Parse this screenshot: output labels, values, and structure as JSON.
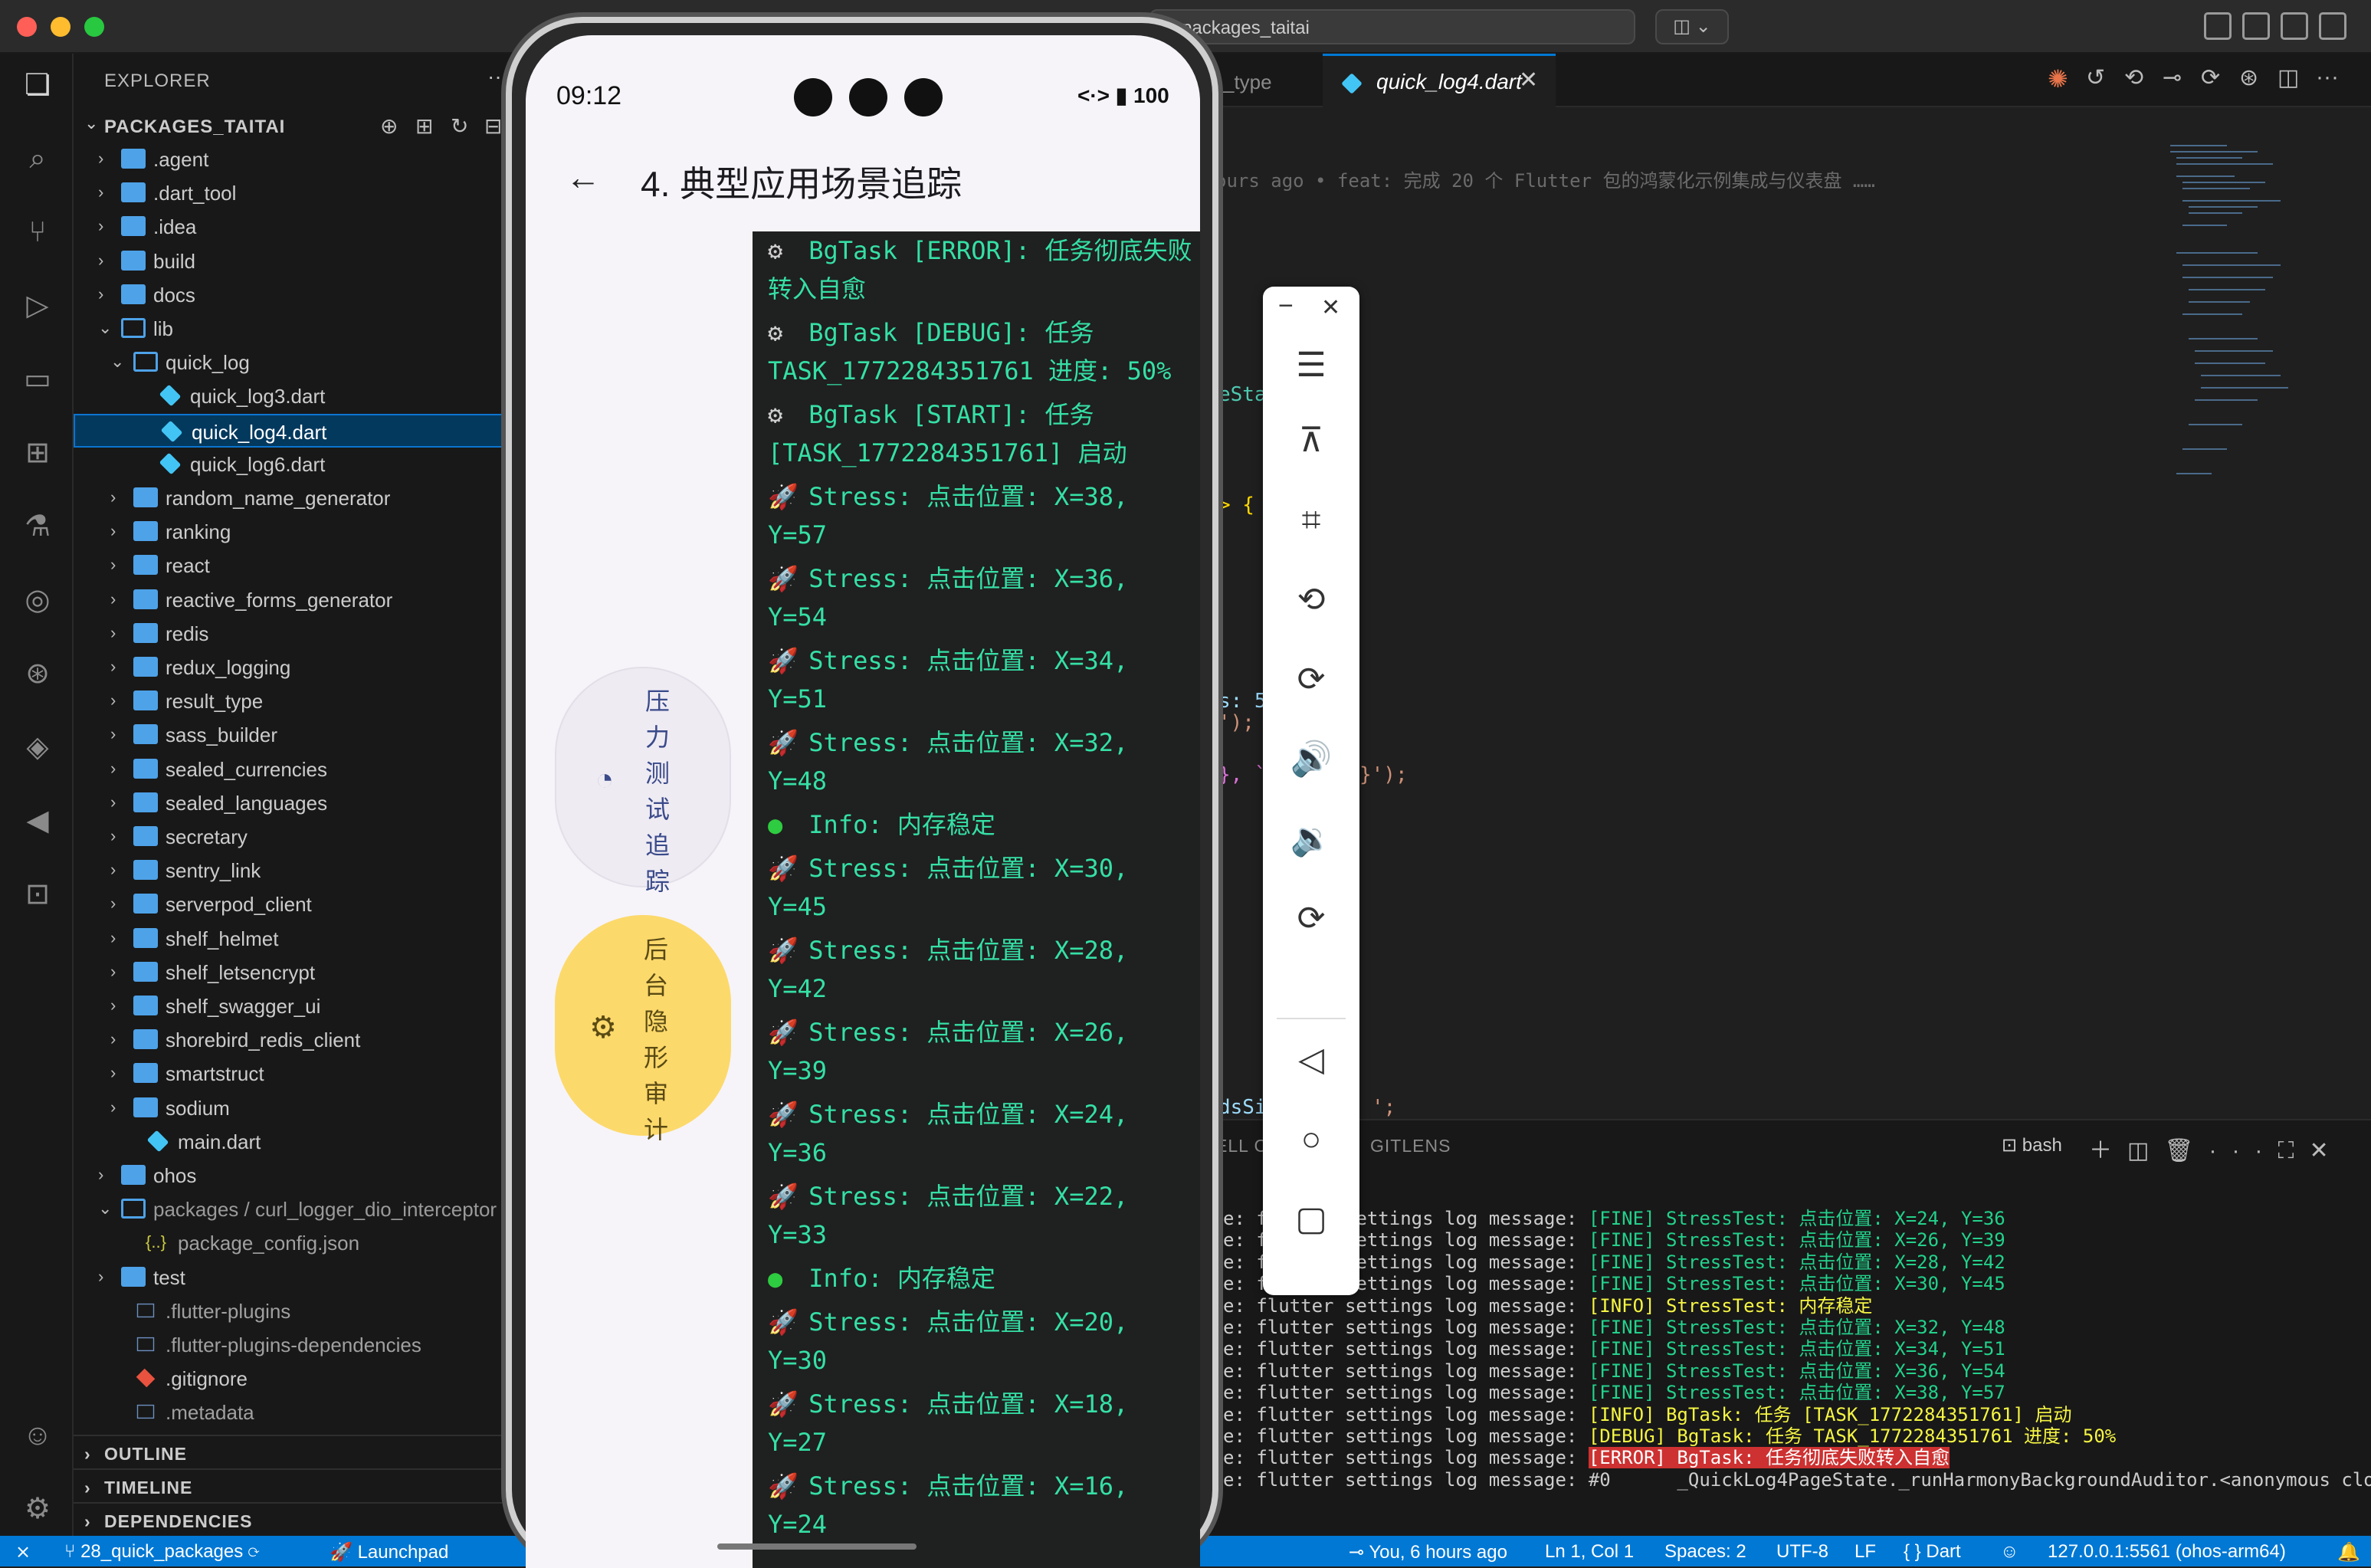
{
  "window": {
    "search_text": "packages_taitai",
    "copilot_label": "⌄"
  },
  "explorer": {
    "title": "EXPLORER",
    "more": "···",
    "workspace": "PACKAGES_TAITAI",
    "tree": [
      {
        "label": ".agent",
        "depth": 0,
        "type": "folder",
        "expanded": false
      },
      {
        "label": ".dart_tool",
        "depth": 0,
        "type": "folder",
        "expanded": false
      },
      {
        "label": ".idea",
        "depth": 0,
        "type": "folder",
        "expanded": false
      },
      {
        "label": "build",
        "depth": 0,
        "type": "folder",
        "expanded": false
      },
      {
        "label": "docs",
        "depth": 0,
        "type": "folder",
        "expanded": false
      },
      {
        "label": "lib",
        "depth": 0,
        "type": "folder",
        "expanded": true
      },
      {
        "label": "quick_log",
        "depth": 1,
        "type": "folder",
        "expanded": true
      },
      {
        "label": "quick_log3.dart",
        "depth": 2,
        "type": "dart"
      },
      {
        "label": "quick_log4.dart",
        "depth": 2,
        "type": "dart",
        "selected": true
      },
      {
        "label": "quick_log6.dart",
        "depth": 2,
        "type": "dart"
      },
      {
        "label": "random_name_generator",
        "depth": 1,
        "type": "folder",
        "expanded": false
      },
      {
        "label": "ranking",
        "depth": 1,
        "type": "folder",
        "expanded": false
      },
      {
        "label": "react",
        "depth": 1,
        "type": "folder",
        "expanded": false
      },
      {
        "label": "reactive_forms_generator",
        "depth": 1,
        "type": "folder",
        "expanded": false
      },
      {
        "label": "redis",
        "depth": 1,
        "type": "folder",
        "expanded": false
      },
      {
        "label": "redux_logging",
        "depth": 1,
        "type": "folder",
        "expanded": false
      },
      {
        "label": "result_type",
        "depth": 1,
        "type": "folder",
        "expanded": false
      },
      {
        "label": "sass_builder",
        "depth": 1,
        "type": "folder",
        "expanded": false
      },
      {
        "label": "sealed_currencies",
        "depth": 1,
        "type": "folder",
        "expanded": false
      },
      {
        "label": "sealed_languages",
        "depth": 1,
        "type": "folder",
        "expanded": false
      },
      {
        "label": "secretary",
        "depth": 1,
        "type": "folder",
        "expanded": false
      },
      {
        "label": "sentry_link",
        "depth": 1,
        "type": "folder",
        "expanded": false
      },
      {
        "label": "serverpod_client",
        "depth": 1,
        "type": "folder",
        "expanded": false
      },
      {
        "label": "shelf_helmet",
        "depth": 1,
        "type": "folder",
        "expanded": false
      },
      {
        "label": "shelf_letsencrypt",
        "depth": 1,
        "type": "folder",
        "expanded": false
      },
      {
        "label": "shelf_swagger_ui",
        "depth": 1,
        "type": "folder",
        "expanded": false
      },
      {
        "label": "shorebird_redis_client",
        "depth": 1,
        "type": "folder",
        "expanded": false
      },
      {
        "label": "smartstruct",
        "depth": 1,
        "type": "folder",
        "expanded": false
      },
      {
        "label": "sodium",
        "depth": 1,
        "type": "folder",
        "expanded": false
      },
      {
        "label": "main.dart",
        "depth": 1,
        "type": "dart"
      },
      {
        "label": "ohos",
        "depth": 0,
        "type": "folder",
        "expanded": false
      },
      {
        "label": "packages / curl_logger_dio_interceptor",
        "depth": 0,
        "type": "folder",
        "expanded": true
      },
      {
        "label": "package_config.json",
        "depth": 1,
        "type": "json"
      },
      {
        "label": "test",
        "depth": 0,
        "type": "folder",
        "expanded": false
      },
      {
        "label": ".flutter-plugins",
        "depth": 0,
        "type": "file"
      },
      {
        "label": ".flutter-plugins-dependencies",
        "depth": 0,
        "type": "file"
      },
      {
        "label": ".gitignore",
        "depth": 0,
        "type": "git"
      },
      {
        "label": ".metadata",
        "depth": 0,
        "type": "file"
      }
    ],
    "sections": [
      "OUTLINE",
      "TIMELINE",
      "DEPENDENCIES"
    ]
  },
  "editor": {
    "prev_tab": "_type",
    "active_tab": "quick_log4.dart",
    "blame": "ours ago • feat: 完成 20 个 Flutter 包的鸿蒙化示例集成与仪表盘 ……",
    "fragments": [
      "eSta",
      "> {",
      "s: 5",
      "');",
      "}, `",
      "}');",
      "dsSi",
      "';"
    ]
  },
  "panel": {
    "tab_output": "ELL C",
    "tab_gitlens": "GITLENS",
    "shell": "bash",
    "lines": [
      {
        "prefix": "e: flutter settings log message: ",
        "tag": "[FINE]",
        "msg": " StressTest: 点击位置: X=24, Y=36",
        "kind": "fine"
      },
      {
        "prefix": "e: flutter settings log message: ",
        "tag": "[FINE]",
        "msg": " StressTest: 点击位置: X=26, Y=39",
        "kind": "fine"
      },
      {
        "prefix": "e: flutter settings log message: ",
        "tag": "[FINE]",
        "msg": " StressTest: 点击位置: X=28, Y=42",
        "kind": "fine"
      },
      {
        "prefix": "e: flutter settings log message: ",
        "tag": "[FINE]",
        "msg": " StressTest: 点击位置: X=30, Y=45",
        "kind": "fine"
      },
      {
        "prefix": "e: flutter settings log message: ",
        "tag": "[INFO]",
        "msg": " StressTest: 内存稳定",
        "kind": "info"
      },
      {
        "prefix": "e: flutter settings log message: ",
        "tag": "[FINE]",
        "msg": " StressTest: 点击位置: X=32, Y=48",
        "kind": "fine"
      },
      {
        "prefix": "e: flutter settings log message: ",
        "tag": "[FINE]",
        "msg": " StressTest: 点击位置: X=34, Y=51",
        "kind": "fine"
      },
      {
        "prefix": "e: flutter settings log message: ",
        "tag": "[FINE]",
        "msg": " StressTest: 点击位置: X=36, Y=54",
        "kind": "fine"
      },
      {
        "prefix": "e: flutter settings log message: ",
        "tag": "[FINE]",
        "msg": " StressTest: 点击位置: X=38, Y=57",
        "kind": "fine"
      },
      {
        "prefix": "e: flutter settings log message: ",
        "tag": "[INFO]",
        "msg": " BgTask: 任务 [TASK_1772284351761] 启动",
        "kind": "info"
      },
      {
        "prefix": "e: flutter settings log message: ",
        "tag": "[DEBUG]",
        "msg": " BgTask: 任务 TASK_1772284351761 进度: 50%",
        "kind": "debug"
      },
      {
        "prefix": "e: flutter settings log message: ",
        "tag": "[ERROR]",
        "msg": " BgTask: 任务彻底失败转入自愈",
        "kind": "err"
      },
      {
        "prefix": "e: flutter settings log message: ",
        "tag": "#0",
        "msg": "      _QuickLog4PageState._runHarmonyBackgroundAuditor.<anonymous clos",
        "kind": "plain"
      }
    ]
  },
  "statusbar": {
    "remote": "⨯",
    "branch": "28_quick_packages",
    "launch": "Launchpad",
    "blame": "You, 6 hours ago",
    "position": "Ln 1, Col 1",
    "spaces": "Spaces: 2",
    "encoding": "UTF-8",
    "eol": "LF",
    "language": "{ } Dart",
    "device": "127.0.0.1:5561 (ohos-arm64)"
  },
  "phone": {
    "time": "09:12",
    "status_right": "<·>  ▮ 100",
    "title": "4. 典型应用场景追踪",
    "buttons": [
      {
        "label": "压力测试追踪",
        "icon": "speedometer-icon",
        "color": "#eeebf3"
      },
      {
        "label": "后台隐形审计",
        "icon": "chip-icon",
        "color": "#fcd96b"
      }
    ],
    "logs": [
      {
        "icon": "⚙",
        "text": "BgTask [ERROR]: 任务彻底失败转入自愈"
      },
      {
        "icon": "⚙",
        "text": "BgTask [DEBUG]: 任务 TASK_1772284351761 进度: 50%"
      },
      {
        "icon": "⚙",
        "text": "BgTask [START]: 任务 [TASK_1772284351761] 启动"
      },
      {
        "icon": "🚀",
        "text": "Stress: 点击位置: X=38, Y=57"
      },
      {
        "icon": "🚀",
        "text": "Stress: 点击位置: X=36, Y=54"
      },
      {
        "icon": "🚀",
        "text": "Stress: 点击位置: X=34, Y=51"
      },
      {
        "icon": "🚀",
        "text": "Stress: 点击位置: X=32, Y=48"
      },
      {
        "icon": "●",
        "text": "Info: 内存稳定"
      },
      {
        "icon": "🚀",
        "text": "Stress: 点击位置: X=30, Y=45"
      },
      {
        "icon": "🚀",
        "text": "Stress: 点击位置: X=28, Y=42"
      },
      {
        "icon": "🚀",
        "text": "Stress: 点击位置: X=26, Y=39"
      },
      {
        "icon": "🚀",
        "text": "Stress: 点击位置: X=24, Y=36"
      },
      {
        "icon": "🚀",
        "text": "Stress: 点击位置: X=22, Y=33"
      },
      {
        "icon": "●",
        "text": "Info: 内存稳定"
      },
      {
        "icon": "🚀",
        "text": "Stress: 点击位置: X=20, Y=30"
      },
      {
        "icon": "🚀",
        "text": "Stress: 点击位置: X=18, Y=27"
      },
      {
        "icon": "🚀",
        "text": "Stress: 点击位置: X=16, Y=24"
      }
    ]
  },
  "floatbar": {
    "minimize": "−",
    "close": "✕",
    "tools": [
      "menu-icon",
      "pin-off-icon",
      "crop-icon",
      "rotate-icon",
      "screenshot-icon",
      "volume-up-icon",
      "volume-down-icon",
      "rotate-device-icon"
    ],
    "nav": [
      "back-triangle-icon",
      "home-circle-icon",
      "recent-square-icon"
    ]
  }
}
